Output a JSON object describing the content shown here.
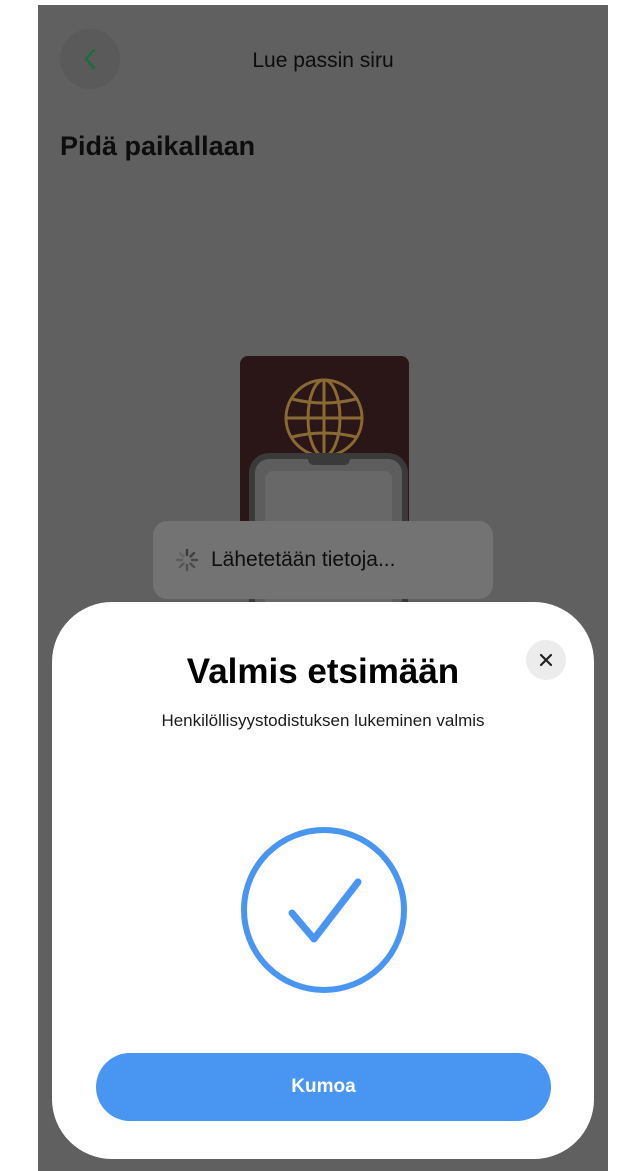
{
  "header": {
    "title": "Lue passin siru",
    "back_icon": "chevron-left-icon"
  },
  "page": {
    "heading": "Pidä paikallaan"
  },
  "illustration": {
    "passport_icon": "passport-globe-icon",
    "phone_icon": "phone-outline-icon"
  },
  "toast": {
    "icon": "spinner-icon",
    "text": "Lähetetään tietoja..."
  },
  "sheet": {
    "title": "Valmis etsimään",
    "subtitle": "Henkilöllisyystodistuksen lukeminen valmis",
    "status_icon": "checkmark-circle-icon",
    "close_icon": "close-icon",
    "cancel_label": "Kumoa"
  },
  "colors": {
    "accent": "#4895f2",
    "back_chevron": "#1e6b3b",
    "passport": "#2a1517",
    "passport_emblem": "#8a6a33",
    "overlay": "#606060"
  }
}
